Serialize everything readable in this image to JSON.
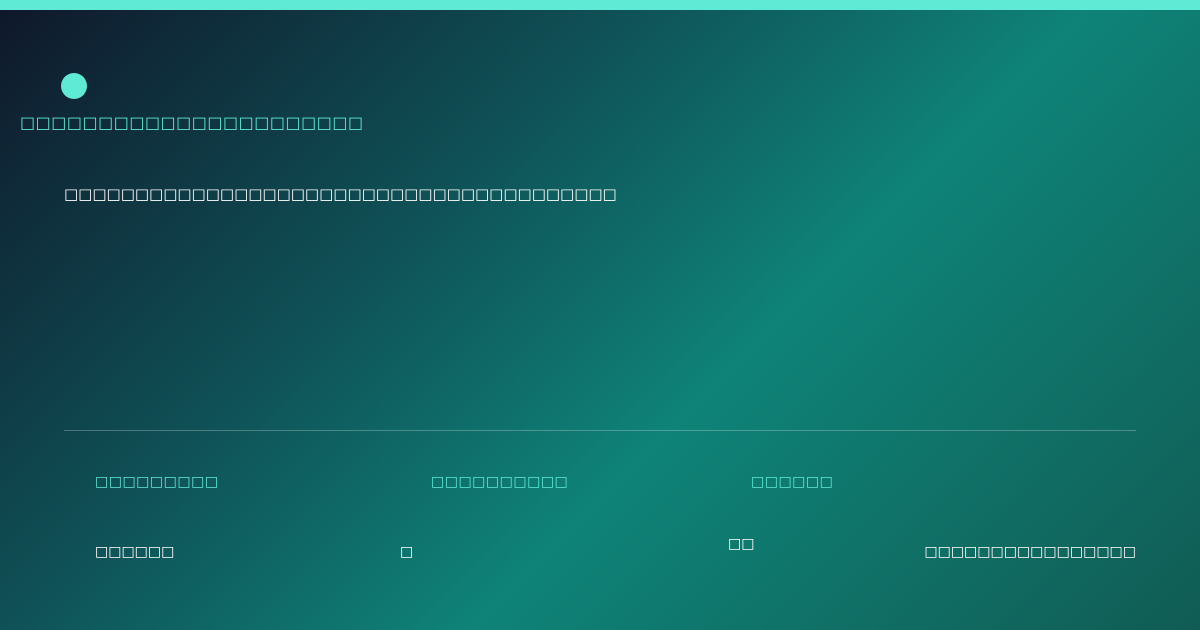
{
  "brand": {
    "accent_color": "#5eead4",
    "tagline": "□□□□□□□□□□□□□□□□□□□□□□"
  },
  "headline": "□□□□□□□□□□□□□□□□□□□□□□□□□□□□□□□□□□□□□□□",
  "footer": {
    "label_1": "□□□□□□□□□",
    "label_2": "□□□□□□□□□□",
    "label_3": "□□□□□□",
    "value_1": "□□□□□□",
    "value_2": "□",
    "value_3": "□□",
    "value_4": "□□□□□□□□□□□□□□□□"
  }
}
